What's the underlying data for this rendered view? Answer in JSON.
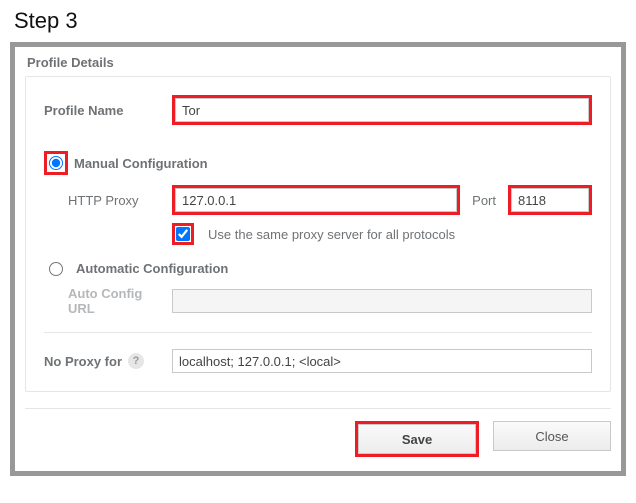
{
  "step_label": "Step 3",
  "group_title": "Profile Details",
  "profile_name": {
    "label": "Profile Name",
    "value": "Tor"
  },
  "manual": {
    "label": "Manual Configuration",
    "http_proxy_label": "HTTP Proxy",
    "http_proxy_value": "127.0.0.1",
    "port_label": "Port",
    "port_value": "8118",
    "same_proxy_label": "Use the same proxy server for all protocols"
  },
  "auto": {
    "label": "Automatic Configuration",
    "url_label": "Auto Config URL",
    "url_value": ""
  },
  "no_proxy": {
    "label": "No Proxy for",
    "value": "localhost; 127.0.0.1; <local>"
  },
  "buttons": {
    "save": "Save",
    "close": "Close"
  }
}
